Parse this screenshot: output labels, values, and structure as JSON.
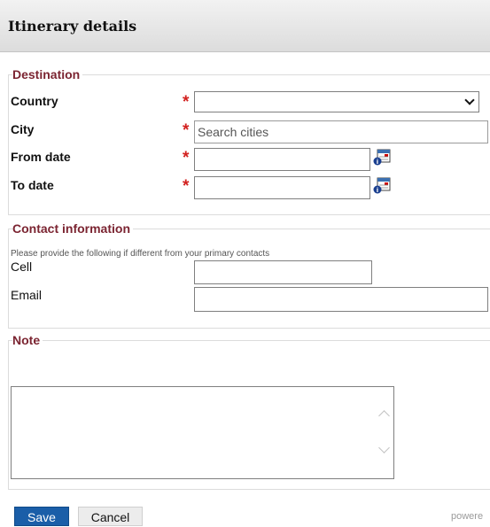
{
  "header": {
    "title": "Itinerary details"
  },
  "destination": {
    "legend": "Destination",
    "country_label": "Country",
    "city_label": "City",
    "city_placeholder": "Search cities",
    "from_label": "From date",
    "to_label": "To date",
    "required_mark": "*"
  },
  "contact": {
    "legend": "Contact information",
    "hint": "Please provide the following if different from your primary contacts",
    "cell_label": "Cell",
    "email_label": "Email"
  },
  "note": {
    "legend": "Note"
  },
  "actions": {
    "save_label": "Save",
    "cancel_label": "Cancel"
  },
  "footer": {
    "powered_text": "powere"
  },
  "colors": {
    "legend": "#7b2431",
    "required": "#d2211f",
    "save_button": "#1a5ea8"
  },
  "icons": [
    "calendar-icon",
    "chevron-down-icon",
    "scroll-up-icon",
    "scroll-down-icon"
  ]
}
